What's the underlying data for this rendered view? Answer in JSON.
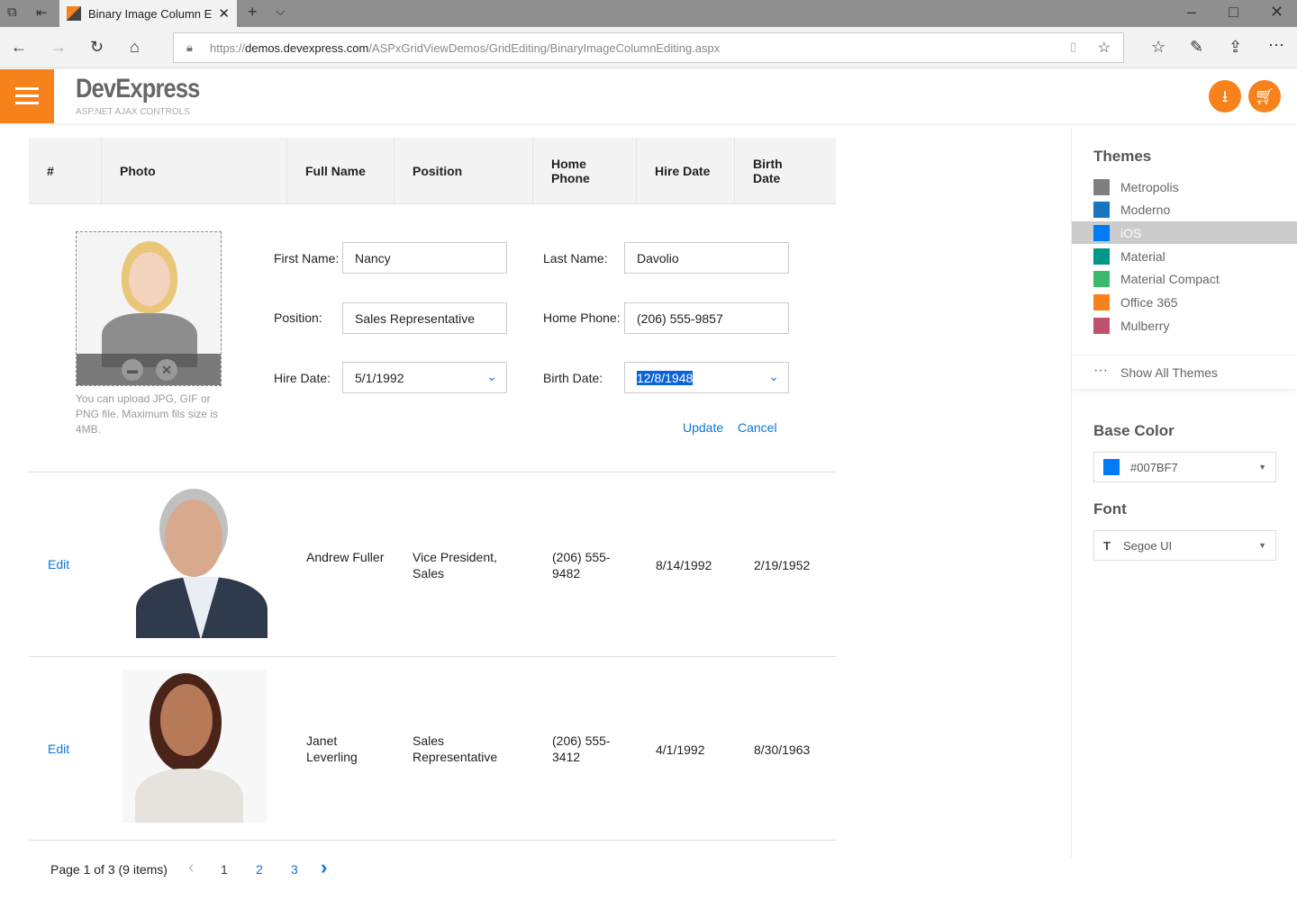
{
  "browser": {
    "tab_title": "Binary Image Column E",
    "url_prefix": "https://",
    "url_domain": "demos.devexpress.com",
    "url_path": "/ASPxGridViewDemos/GridEditing/BinaryImageColumnEditing.aspx"
  },
  "brand": {
    "name": "DevExpress",
    "subtitle": "ASP.NET AJAX CONTROLS",
    "accent": "#F7821B"
  },
  "grid": {
    "columns": [
      "#",
      "Photo",
      "Full Name",
      "Position",
      "Home Phone",
      "Hire Date",
      "Birth Date"
    ],
    "edit_form": {
      "upload_hint": "You can upload JPG, GIF or PNG file. Maximum fils size is 4MB.",
      "first_name_label": "First Name:",
      "first_name": "Nancy",
      "last_name_label": "Last Name:",
      "last_name": "Davolio",
      "position_label": "Position:",
      "position": "Sales Representative",
      "home_phone_label": "Home Phone:",
      "home_phone": "(206) 555-9857",
      "hire_date_label": "Hire Date:",
      "hire_date": "5/1/1992",
      "birth_date_label": "Birth Date:",
      "birth_date": "12/8/1948",
      "update": "Update",
      "cancel": "Cancel"
    },
    "rows": [
      {
        "action": "Edit",
        "full_name": "Andrew Fuller",
        "position": "Vice President, Sales",
        "home_phone": "(206) 555-9482",
        "hire_date": "8/14/1992",
        "birth_date": "2/19/1952"
      },
      {
        "action": "Edit",
        "full_name": "Janet Leverling",
        "position": "Sales Representative",
        "home_phone": "(206) 555-3412",
        "hire_date": "4/1/1992",
        "birth_date": "8/30/1963"
      }
    ],
    "pager": {
      "summary": "Page 1 of 3 (9 items)",
      "pages": [
        "1",
        "2",
        "3"
      ],
      "current": "1"
    }
  },
  "sidebar": {
    "themes_title": "Themes",
    "themes": [
      {
        "name": "Metropolis",
        "color": "#7F7F7F"
      },
      {
        "name": "Moderno",
        "color": "#1B75BC"
      },
      {
        "name": "iOS",
        "color": "#007BF7",
        "selected": true
      },
      {
        "name": "Material",
        "color": "#009688"
      },
      {
        "name": "Material Compact",
        "color": "#3CB96B"
      },
      {
        "name": "Office 365",
        "color": "#F7821B"
      },
      {
        "name": "Mulberry",
        "color": "#C0506E"
      }
    ],
    "show_all": "Show All Themes",
    "base_color_title": "Base Color",
    "base_color": "#007BF7",
    "font_title": "Font",
    "font": "Segoe UI"
  }
}
